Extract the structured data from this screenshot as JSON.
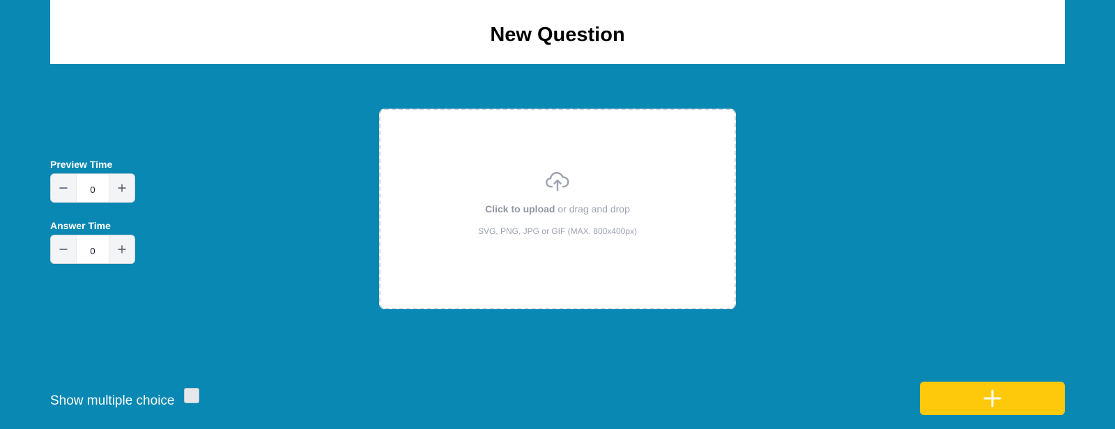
{
  "header": {
    "title": "New Question"
  },
  "timers": {
    "preview": {
      "label": "Preview Time",
      "value": "0"
    },
    "answer": {
      "label": "Answer Time",
      "value": "0"
    }
  },
  "upload": {
    "icon": "cloud-upload-icon",
    "click_text": "Click to upload",
    "rest_text": " or drag and drop",
    "hint": "SVG, PNG, JPG or GIF (MAX. 800x400px)"
  },
  "multiple_choice": {
    "label": "Show multiple choice",
    "checked": false
  },
  "add_button": {
    "icon": "plus-icon"
  },
  "colors": {
    "background": "#0888b2",
    "accent": "#fdc90a",
    "header_bg": "#ffffff"
  }
}
